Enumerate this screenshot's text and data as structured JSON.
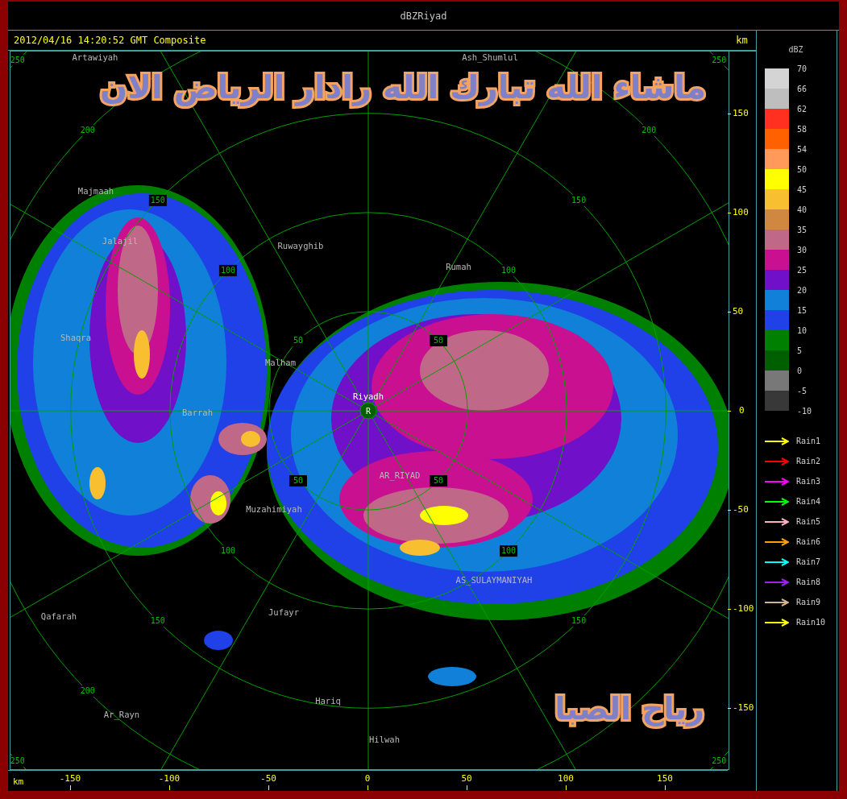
{
  "window": {
    "title": "dBZRiyad"
  },
  "header": {
    "timestamp": "2012/04/16 14:20:52 GMT Composite",
    "unit": "km"
  },
  "map": {
    "caption": "ماشاء الله تبارك الله رادار الرياض الان",
    "signature": "رياح الصبا",
    "range_rings": [
      {
        "labels": [
          "50",
          "50",
          "50",
          "50"
        ]
      },
      {
        "labels": [
          "100",
          "100",
          "100",
          "100"
        ]
      },
      {
        "labels": [
          "150",
          "150",
          "150",
          "150"
        ]
      },
      {
        "labels": [
          "200",
          "200",
          "200"
        ]
      },
      {
        "labels": [
          "250",
          "250",
          "250",
          "250"
        ]
      }
    ],
    "places": [
      {
        "name": "Artawiyah"
      },
      {
        "name": "Ash_Shumlul"
      },
      {
        "name": "Majmaah"
      },
      {
        "name": "Jalajil"
      },
      {
        "name": "Ruwayghib"
      },
      {
        "name": "Rumah"
      },
      {
        "name": "Shaqra"
      },
      {
        "name": "Malham"
      },
      {
        "name": "Barrah"
      },
      {
        "name": "AR_RIYAD"
      },
      {
        "name": "Muzahimiyah"
      },
      {
        "name": "AS_SULAYMANIYAH"
      },
      {
        "name": "Qafarah"
      },
      {
        "name": "Jufayr"
      },
      {
        "name": "Hariq"
      },
      {
        "name": "Ar_Rayn"
      },
      {
        "name": "Hilwah"
      }
    ],
    "site": {
      "name": "Riyadh",
      "marker": "R"
    }
  },
  "y_axis": {
    "ticks": [
      "150",
      "100",
      "50",
      "0",
      "-50",
      "-100",
      "-150"
    ]
  },
  "x_axis": {
    "unit": "km",
    "ticks": [
      "-150",
      "-100",
      "-50",
      "0",
      "50",
      "100",
      "150"
    ]
  },
  "legend": {
    "unit": "dBZ",
    "swatches": [
      {
        "color": "#d4d4d4"
      },
      {
        "color": "#bebebe"
      },
      {
        "color": "#ff3020"
      },
      {
        "color": "#ff6000"
      },
      {
        "color": "#ff9a5a"
      },
      {
        "color": "#ffff00"
      },
      {
        "color": "#f8c030"
      },
      {
        "color": "#d08840"
      },
      {
        "color": "#c06888"
      },
      {
        "color": "#c81090"
      },
      {
        "color": "#7010c8"
      },
      {
        "color": "#1080d8"
      },
      {
        "color": "#2040e8"
      },
      {
        "color": "#008000"
      },
      {
        "color": "#006000"
      },
      {
        "color": "#787878"
      },
      {
        "color": "#383838"
      }
    ],
    "ticks": [
      "70",
      "66",
      "62",
      "58",
      "54",
      "50",
      "45",
      "40",
      "35",
      "30",
      "25",
      "20",
      "15",
      "10",
      "5",
      "0",
      "-5",
      "-10"
    ],
    "rain_tracks": [
      {
        "label": "Rain1",
        "color": "#ffff00"
      },
      {
        "label": "Rain2",
        "color": "#ff0000"
      },
      {
        "label": "Rain3",
        "color": "#ff00ff"
      },
      {
        "label": "Rain4",
        "color": "#00ff00"
      },
      {
        "label": "Rain5",
        "color": "#ffb0c0"
      },
      {
        "label": "Rain6",
        "color": "#ffa000"
      },
      {
        "label": "Rain7",
        "color": "#00ffff"
      },
      {
        "label": "Rain8",
        "color": "#a020f0"
      },
      {
        "label": "Rain9",
        "color": "#d2b48c"
      },
      {
        "label": "Rain10",
        "color": "#ffff00"
      }
    ]
  }
}
